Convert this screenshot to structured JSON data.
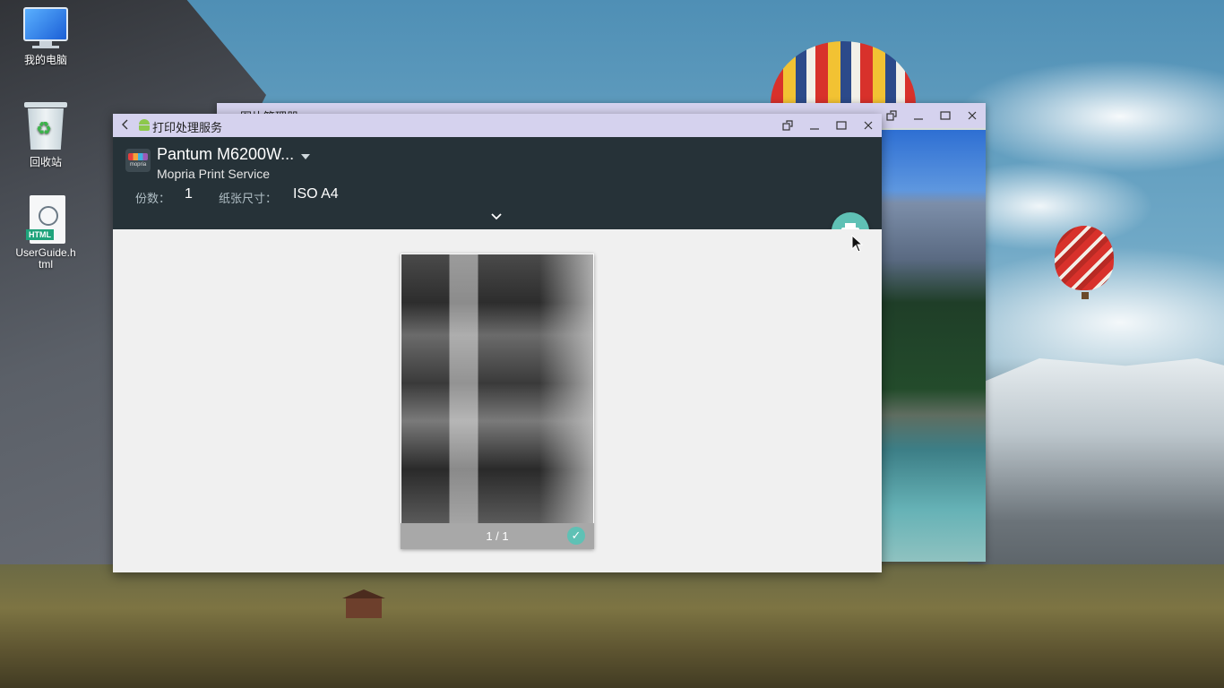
{
  "desktop": {
    "icons": [
      {
        "label": "我的电脑",
        "icon": "computer-icon"
      },
      {
        "label": "回收站",
        "icon": "recycle-bin-icon"
      },
      {
        "label": "UserGuide.h\ntml",
        "icon": "html-file-icon",
        "badge": "HTML"
      }
    ]
  },
  "background_window": {
    "title": "图片管理器",
    "controls": [
      "rotate-icon",
      "minimize-icon",
      "maximize-icon",
      "close-icon"
    ]
  },
  "print_window": {
    "title": "打印处理服务",
    "controls": [
      "rotate-icon",
      "minimize-icon",
      "maximize-icon",
      "close-icon"
    ],
    "printer": {
      "name": "Pantum M6200W...",
      "service": "Mopria Print Service",
      "logo_text": "mopria"
    },
    "copies_label": "份数：",
    "copies_value": "1",
    "paper_size_label": "纸张尺寸：",
    "paper_size_value": "ISO A4",
    "preview": {
      "page_indicator": "1 / 1",
      "selected": true
    },
    "accent_color": "#5fc1b5",
    "header_color": "#263238",
    "titlebar_color": "#d5d2ee"
  }
}
